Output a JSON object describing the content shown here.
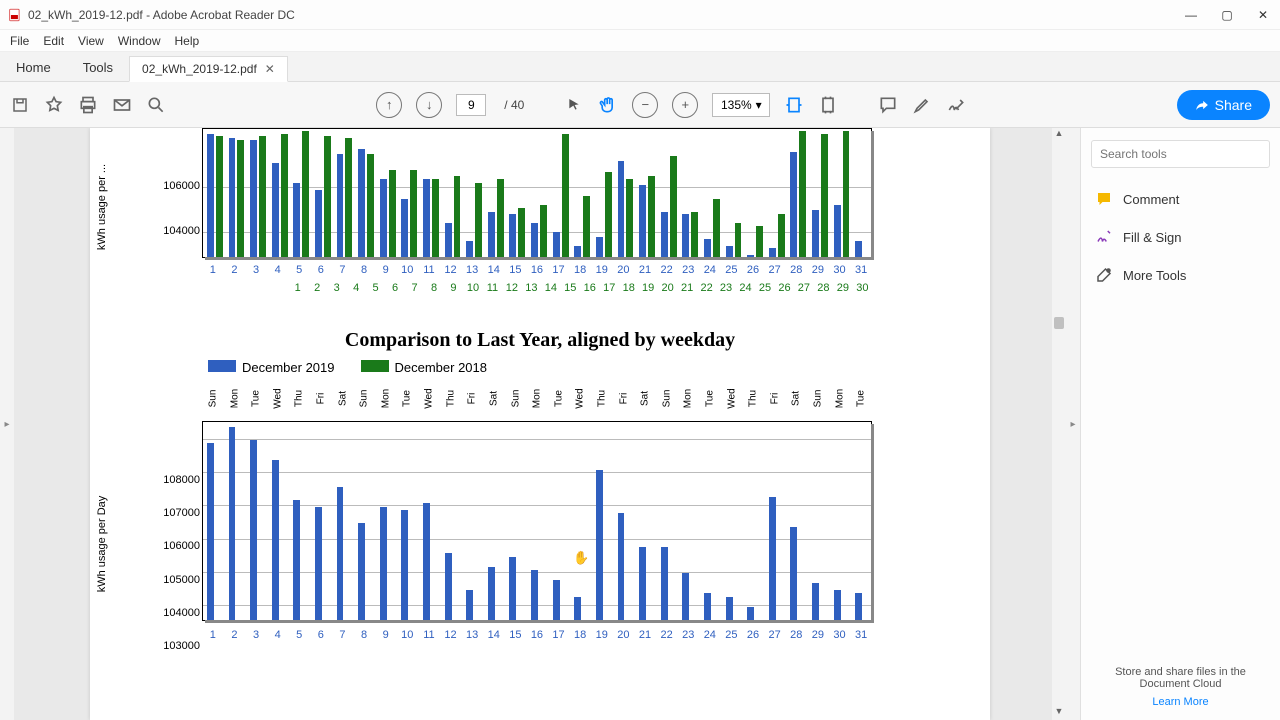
{
  "window": {
    "title": "02_kWh_2019-12.pdf - Adobe Acrobat Reader DC"
  },
  "menu": {
    "file": "File",
    "edit": "Edit",
    "view": "View",
    "window": "Window",
    "help": "Help"
  },
  "tabs": {
    "home": "Home",
    "tools": "Tools",
    "file": "02_kWh_2019-12.pdf"
  },
  "toolbar": {
    "page_current": "9",
    "page_sep": "/",
    "page_total": "40",
    "zoom": "135%",
    "share": "Share"
  },
  "rhp": {
    "search_placeholder": "Search tools",
    "comment": "Comment",
    "fillsign": "Fill & Sign",
    "moretools": "More Tools",
    "footer1": "Store and share files in the",
    "footer2": "Document Cloud",
    "learn": "Learn More"
  },
  "chart_data": [
    {
      "id": "top_partial",
      "type": "bar",
      "ylabel": "kWh usage per ...",
      "ylim": [
        102500,
        108500
      ],
      "yticks": [
        104000,
        106000
      ],
      "series": [
        {
          "name": "December 2019",
          "color": "#2f5fbf",
          "categories": [
            1,
            2,
            3,
            4,
            5,
            6,
            7,
            8,
            9,
            10,
            11,
            12,
            13,
            14,
            15,
            16,
            17,
            18,
            19,
            20,
            21,
            22,
            23,
            24,
            25,
            26,
            27,
            28,
            29,
            30,
            31
          ],
          "values": [
            108300,
            108100,
            108000,
            107000,
            106100,
            105800,
            107400,
            107600,
            106300,
            105400,
            106300,
            104300,
            103500,
            104800,
            104700,
            104300,
            103900,
            103300,
            103700,
            107100,
            106000,
            104800,
            104700,
            103600,
            103300,
            102900,
            103200,
            107500,
            104900,
            105100,
            103500
          ]
        },
        {
          "name": "December 2018",
          "color": "#1a7a1a",
          "categories": [
            1,
            2,
            3,
            4,
            5,
            6,
            7,
            8,
            9,
            10,
            11,
            12,
            13,
            14,
            15,
            16,
            17,
            18,
            19,
            20,
            21,
            22,
            23,
            24,
            25,
            26,
            27,
            28,
            29,
            30
          ],
          "values": [
            108200,
            108000,
            108200,
            108300,
            108400,
            108200,
            108100,
            107400,
            106700,
            106700,
            106300,
            106400,
            106100,
            106300,
            105000,
            105100,
            108300,
            105500,
            106600,
            106300,
            106400,
            107300,
            104800,
            105400,
            104300,
            104200,
            104700,
            108400,
            108300,
            108400
          ]
        }
      ]
    },
    {
      "id": "bottom_full",
      "type": "bar",
      "title": "Comparison to Last Year, aligned by weekday",
      "ylabel": "kWh usage per Day",
      "ylim": [
        102500,
        108500
      ],
      "yticks": [
        103000,
        104000,
        105000,
        106000,
        107000,
        108000
      ],
      "legend": [
        {
          "name": "December 2019",
          "color": "#2f5fbf"
        },
        {
          "name": "December 2018",
          "color": "#1a7a1a"
        }
      ],
      "weekdays": [
        "Sun",
        "Mon",
        "Tue",
        "Wed",
        "Thu",
        "Fri",
        "Sat",
        "Sun",
        "Mon",
        "Tue",
        "Wed",
        "Thu",
        "Fri",
        "Sat",
        "Sun",
        "Mon",
        "Tue",
        "Wed",
        "Thu",
        "Fri",
        "Sat",
        "Sun",
        "Mon",
        "Tue",
        "Wed",
        "Thu",
        "Fri",
        "Sat",
        "Sun",
        "Mon",
        "Tue"
      ],
      "categories": [
        1,
        2,
        3,
        4,
        5,
        6,
        7,
        8,
        9,
        10,
        11,
        12,
        13,
        14,
        15,
        16,
        17,
        18,
        19,
        20,
        21,
        22,
        23,
        24,
        25,
        26,
        27,
        28,
        29,
        30,
        31
      ],
      "series": [
        {
          "name": "December 2019",
          "color": "#2f5fbf",
          "values": [
            107800,
            108300,
            107900,
            107300,
            106100,
            105900,
            106500,
            105400,
            105900,
            105800,
            106000,
            104500,
            103400,
            104100,
            104400,
            104000,
            103700,
            103200,
            107000,
            105700,
            104700,
            104700,
            103900,
            103300,
            103200,
            102900,
            106200,
            105300,
            103600,
            103400,
            103300
          ]
        }
      ]
    }
  ]
}
